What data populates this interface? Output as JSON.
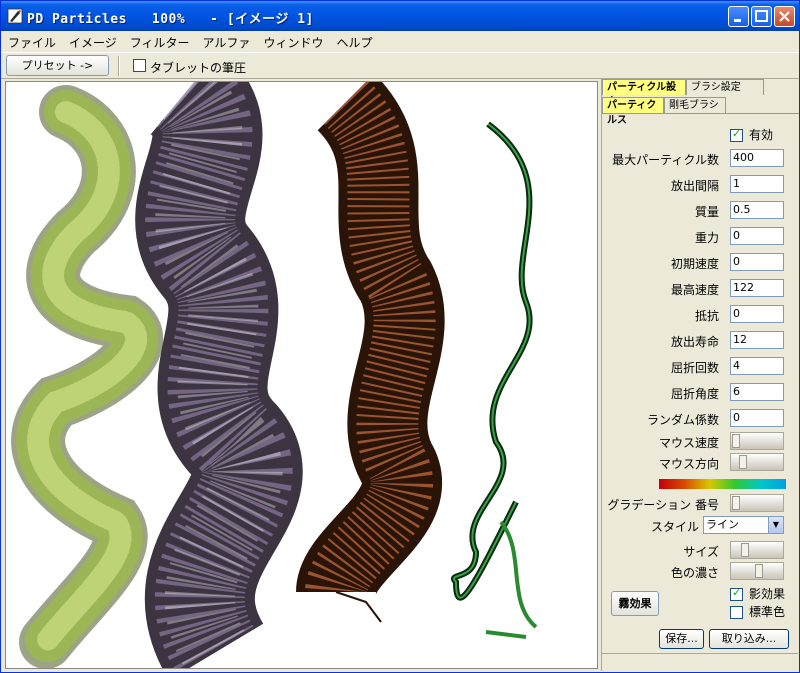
{
  "window": {
    "title": "PD Particles   100%   - [イメージ 1]"
  },
  "menu": [
    "ファイル",
    "イメージ",
    "フィルター",
    "アルファ",
    "ウィンドウ",
    "ヘルプ"
  ],
  "toolbar": {
    "preset_label": "プリセット  ->",
    "tablet_pressure_label": "タブレットの筆圧",
    "tablet_pressure_checked": false
  },
  "panel": {
    "tabs_top": [
      "パーティクル設定",
      "ブラシ設定"
    ],
    "tabs_sub": [
      "パーティクルス",
      "剛毛ブラシ"
    ],
    "enabled_label": "有効",
    "enabled_checked": true,
    "fields": [
      {
        "label": "最大パーティクル数",
        "value": "400"
      },
      {
        "label": "放出間隔",
        "value": "1"
      },
      {
        "label": "質量",
        "value": "0.5"
      },
      {
        "label": "重力",
        "value": "0"
      },
      {
        "label": "初期速度",
        "value": "0"
      },
      {
        "label": "最高速度",
        "value": "122"
      },
      {
        "label": "抵抗",
        "value": "0"
      },
      {
        "label": "放出寿命",
        "value": "12"
      },
      {
        "label": "屈折回数",
        "value": "4"
      },
      {
        "label": "屈折角度",
        "value": "6"
      },
      {
        "label": "ランダム係数",
        "value": "0"
      }
    ],
    "mouse_speed_label": "マウス速度",
    "mouse_direction_label": "マウス方向",
    "gradient_number_label": "グラデーション 番号",
    "style_label": "スタイル",
    "style_value": "ライン",
    "size_label": "サイズ",
    "color_density_label": "色の濃さ",
    "fog_button": "霧効果",
    "shadow_label": "影効果",
    "shadow_checked": true,
    "standard_color_label": "標準色",
    "standard_color_checked": false,
    "save_button": "保存...",
    "import_button": "取り込み..."
  },
  "colors": {
    "title_bar": "#0054e3",
    "tab_active": "#ffff80",
    "panel_bg": "#ece9d8",
    "canvas_bg": "#ffffff"
  }
}
